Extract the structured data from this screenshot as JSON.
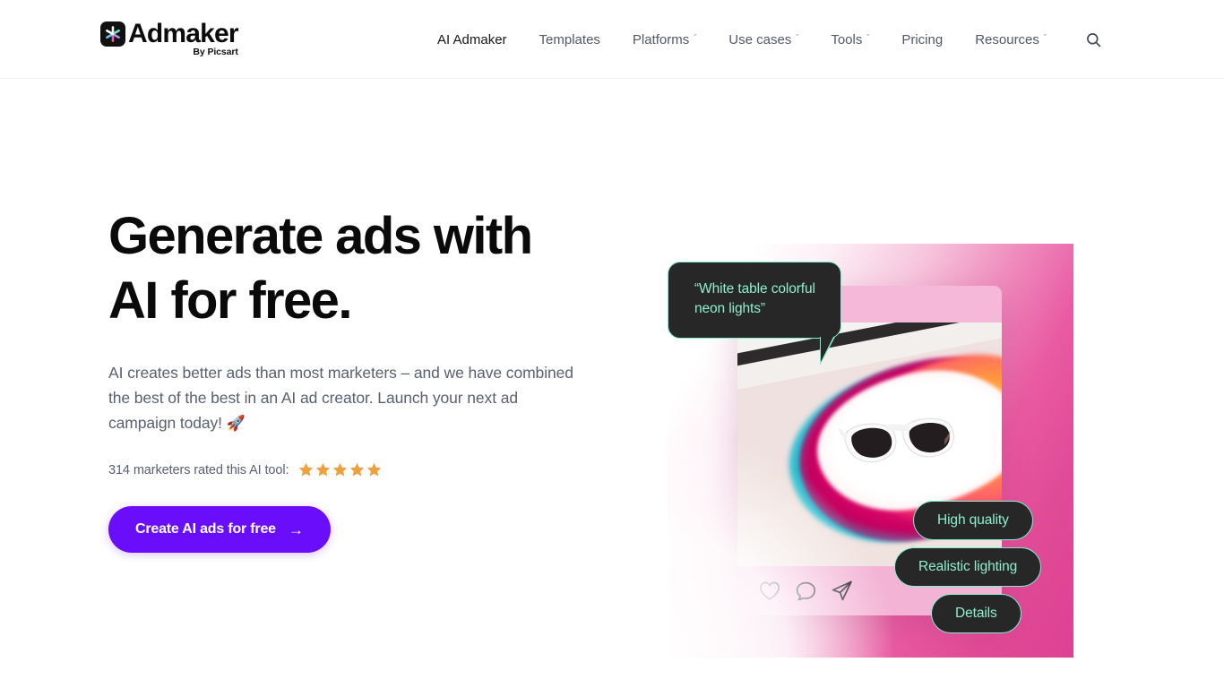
{
  "header": {
    "brand": {
      "name": "Admaker",
      "tagline": "By Picsart",
      "mark_icon": "picsart-asterisk-icon"
    },
    "nav": [
      {
        "label": "AI Admaker",
        "has_dropdown": false,
        "active": true
      },
      {
        "label": "Templates",
        "has_dropdown": false,
        "active": false
      },
      {
        "label": "Platforms",
        "has_dropdown": true,
        "active": false
      },
      {
        "label": "Use cases",
        "has_dropdown": true,
        "active": false
      },
      {
        "label": "Tools",
        "has_dropdown": true,
        "active": false
      },
      {
        "label": "Pricing",
        "has_dropdown": false,
        "active": false
      },
      {
        "label": "Resources",
        "has_dropdown": true,
        "active": false
      }
    ],
    "caret_glyph": "ˇ",
    "search_icon": "search-icon"
  },
  "hero": {
    "title_line1": "Generate ads with",
    "title_line2": "AI for free.",
    "subtitle": "AI creates better ads than most marketers – and we have combined the best of the best in an AI ad creator. Launch your next ad campaign today!",
    "subtitle_emoji": "🚀",
    "rating_text": "314 marketers rated this AI tool:",
    "rating_count": 314,
    "stars_filled": 5,
    "star_color": "#efa03f",
    "cta_label": "Create AI ads for free",
    "cta_arrow": "→",
    "cta_color": "#6a0dfa"
  },
  "visual": {
    "prompt": "“White table colorful neon lights”",
    "pills": [
      {
        "label": "High quality"
      },
      {
        "label": "Realistic lighting"
      },
      {
        "label": "Details"
      }
    ],
    "post_actions": [
      {
        "icon": "heart-icon"
      },
      {
        "icon": "comment-icon"
      },
      {
        "icon": "send-icon"
      }
    ],
    "accent_color": "#8defcd",
    "bubble_bg": "#272727",
    "backdrop_color": "#dd4292",
    "subject": "white-sunglasses-image"
  }
}
